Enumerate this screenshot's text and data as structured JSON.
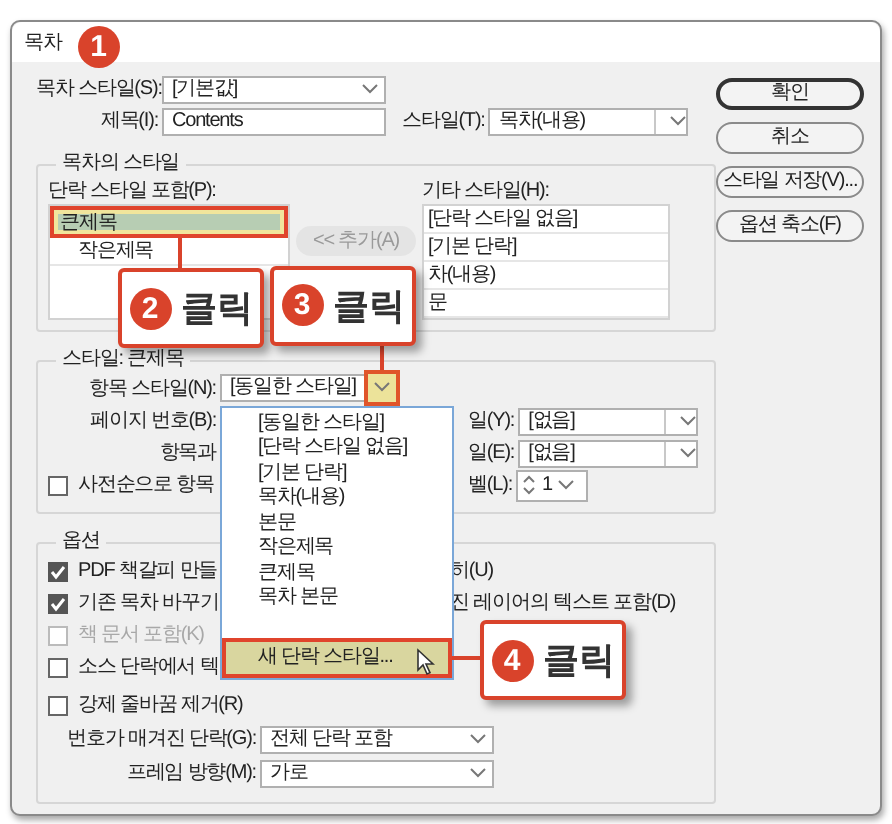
{
  "window": {
    "title": "목차",
    "step_badge": "1"
  },
  "toc_style": {
    "label": "목차 스타일(S):",
    "value": "[기본값]"
  },
  "title_field": {
    "label": "제목(I):",
    "value": "Contents"
  },
  "title_style": {
    "label": "스타일(T):",
    "value": "목차(내용)"
  },
  "buttons": [
    {
      "label": "확인",
      "default": true
    },
    {
      "label": "취소",
      "default": false
    },
    {
      "label": "스타일 저장(V)...",
      "default": false
    },
    {
      "label": "옵션 축소(F)",
      "default": false
    }
  ],
  "styles_group": {
    "title": "목차의 스타일",
    "include_label": "단락 스타일 포함(P):",
    "include_items": [
      {
        "label": "큰제목",
        "selected": true,
        "children": [
          {
            "label": "작은제목",
            "selected": false
          }
        ]
      }
    ],
    "add_button": {
      "label": "<< 추가(A)",
      "disabled": true
    },
    "other_label": "기타 스타일(H):",
    "other_items": [
      "[단락 스타일 없음]",
      "[기본 단락]",
      "차(내용)",
      "문"
    ]
  },
  "style_group": {
    "title": "스타일: 큰제목",
    "entry_style": {
      "label": "항목 스타일(N):",
      "value": "[동일한 스타일]",
      "expanded": true
    },
    "page_number_label": "페이지 번호(B):",
    "between_label": "항목과",
    "sort": {
      "label": "사전순으로 항목",
      "checked": false
    },
    "right_fields": [
      {
        "label": "일(Y):",
        "value": "[없음]"
      },
      {
        "label": "일(E):",
        "value": "[없음]"
      }
    ],
    "level": {
      "label": "벨(L):",
      "value": "1"
    }
  },
  "dropdown": {
    "items": [
      {
        "label": "[동일한 스타일]",
        "kind": "option",
        "selected": false
      },
      {
        "label": "[단락 스타일 없음]",
        "kind": "option",
        "selected": false
      },
      {
        "label": "[기본 단락]",
        "kind": "option",
        "selected": false
      },
      {
        "label": "목차(내용)",
        "kind": "option",
        "selected": false
      },
      {
        "label": "본문",
        "kind": "option",
        "selected": false
      },
      {
        "label": "작은제목",
        "kind": "option",
        "selected": false
      },
      {
        "label": "큰제목",
        "kind": "option",
        "selected": false
      },
      {
        "label": "목차 본문",
        "kind": "option",
        "selected": false
      },
      {
        "label": "새 단락 스타일...",
        "kind": "command",
        "selected": true
      }
    ]
  },
  "options_group": {
    "title": "옵션",
    "checkboxes": [
      {
        "label": "PDF 책갈피 만들",
        "checked": true,
        "disabled": false,
        "right_text": "히(U)"
      },
      {
        "label": "기존 목차 바꾸기",
        "checked": true,
        "disabled": false,
        "right_text": "진 레이어의 텍스트 포함(D)"
      },
      {
        "label": "책 문서 포함(K)",
        "checked": false,
        "disabled": true
      },
      {
        "label": "소스 단락에서 텍",
        "checked": false,
        "disabled": false
      },
      {
        "label": "강제 줄바꿈 제거(R)",
        "checked": false,
        "disabled": false
      }
    ],
    "numbered": {
      "label": "번호가 매겨진 단락(G):",
      "value": "전체 단락 포함"
    },
    "frame": {
      "label": "프레임 방향(M):",
      "value": "가로"
    }
  },
  "callouts": [
    {
      "number": "2",
      "text": "클릭"
    },
    {
      "number": "3",
      "text": "클릭"
    },
    {
      "number": "4",
      "text": "클릭"
    }
  ]
}
